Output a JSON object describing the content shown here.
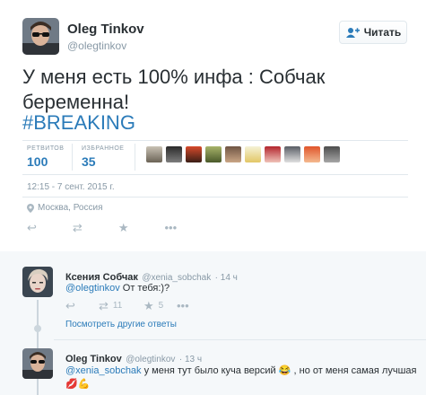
{
  "tweet": {
    "author_name": "Oleg Tinkov",
    "author_handle": "@olegtinkov",
    "follow_label": "Читать",
    "text": "У меня есть 100% инфа : Собчак беременна!",
    "hashtag": "#BREAKING",
    "stats": {
      "retweets_label": "РЕТВИТОВ",
      "retweets_value": "100",
      "likes_label": "ИЗБРАННОЕ",
      "likes_value": "35"
    },
    "timestamp": "12:15 - 7 сент. 2015 г.",
    "location": "Москва, Россия"
  },
  "replies": [
    {
      "author_name": "Ксения Собчак",
      "author_handle": "@xenia_sobchak",
      "time": "· 14 ч",
      "mention": "@olegtinkov",
      "text": " От тебя:)?",
      "retweets": "11",
      "likes": "5",
      "more_label": "Посмотреть другие ответы"
    },
    {
      "author_name": "Oleg Tinkov",
      "author_handle": "@olegtinkov",
      "time": "· 13 ч",
      "mention": "@xenia_sobchak",
      "text": " у меня тут было куча версий 😂 , но от меня самая лучшая",
      "emoji_line": "💋💪"
    }
  ],
  "colors": {
    "link": "#2b7bb9",
    "muted": "#8899a6",
    "divider": "#e1e8ed"
  }
}
